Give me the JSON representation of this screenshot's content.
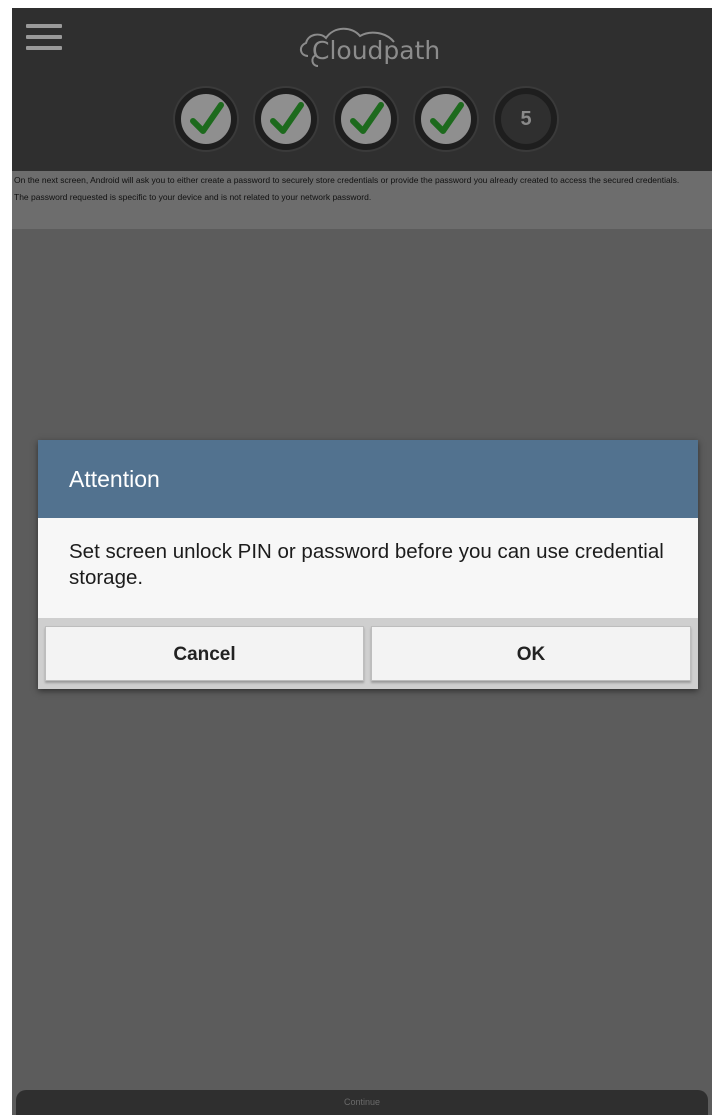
{
  "header": {
    "logo_text": "Cloudpath",
    "menu_icon": "hamburger-menu-icon",
    "steps": [
      {
        "state": "done",
        "icon": "check-icon"
      },
      {
        "state": "done",
        "icon": "check-icon"
      },
      {
        "state": "done",
        "icon": "check-icon"
      },
      {
        "state": "done",
        "icon": "check-icon"
      },
      {
        "state": "pending",
        "label": "5"
      }
    ]
  },
  "info": {
    "paragraph_1": "On the next screen, Android will ask you to either create a password to securely store credentials or provide the password you already created to access the secured credentials.",
    "paragraph_2": "The password requested is specific to your device and is not related to your network password."
  },
  "dialog": {
    "title": "Attention",
    "message": "Set screen unlock PIN or password before you can use credential storage.",
    "cancel_label": "Cancel",
    "ok_label": "OK"
  },
  "footer": {
    "continue_label": "Continue"
  },
  "colors": {
    "dialog_header": "#52728f",
    "check_green": "#1d6a1d",
    "topbar": "#2f2f2f",
    "overlay": "#5c5c5c"
  }
}
